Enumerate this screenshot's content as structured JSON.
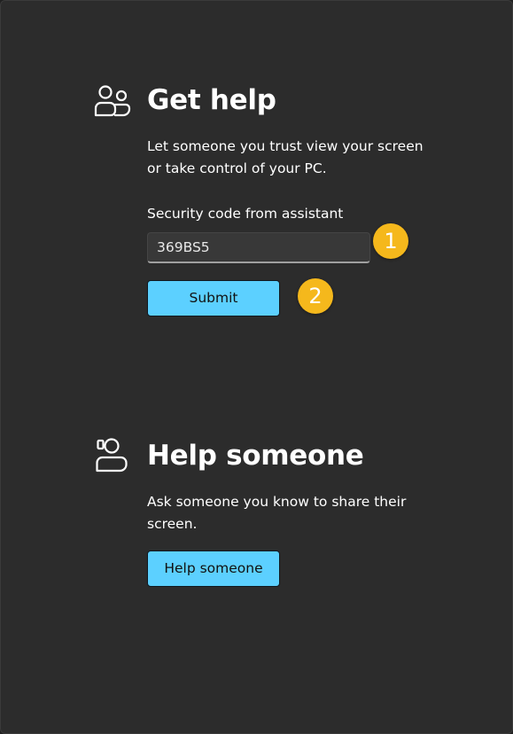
{
  "get_help": {
    "icon": "people-icon",
    "title": "Get help",
    "description_line1": "Let someone you trust view your screen",
    "description_line2": "or take control of your PC.",
    "code_label": "Security code from assistant",
    "code_value": "369BS5",
    "submit_label": "Submit"
  },
  "help_someone": {
    "icon": "person-with-screen-icon",
    "title": "Help someone",
    "description_line1": "Ask someone you know to share their",
    "description_line2": "screen.",
    "button_label": "Help someone"
  },
  "annotations": {
    "badge_1": "1",
    "badge_2": "2"
  },
  "colors": {
    "background": "#2c2c2c",
    "accent_button": "#5cd0ff",
    "badge": "#f5b81c"
  }
}
